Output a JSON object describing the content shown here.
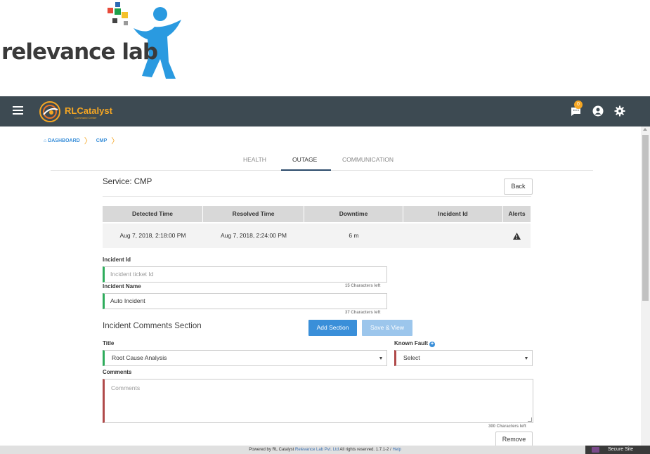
{
  "logo": {
    "text": "relevance lab"
  },
  "topbar": {
    "brand": "RLCatalyst",
    "brand_sub": "Command Center",
    "notification_count": "0"
  },
  "breadcrumb": [
    {
      "label": "DASHBOARD"
    },
    {
      "label": "CMP"
    }
  ],
  "tabs": [
    {
      "label": "HEALTH",
      "active": false
    },
    {
      "label": "OUTAGE",
      "active": true
    },
    {
      "label": "COMMUNICATION",
      "active": false
    }
  ],
  "service": {
    "title": "Service: CMP",
    "back_label": "Back"
  },
  "table": {
    "headers": [
      "Detected Time",
      "Resolved Time",
      "Downtime",
      "Incident Id",
      "Alerts"
    ],
    "rows": [
      {
        "detected": "Aug 7, 2018, 2:18:00 PM",
        "resolved": "Aug 7, 2018, 2:24:00 PM",
        "downtime": "6 m",
        "incident_id": "",
        "alert_icon": "warning-icon"
      }
    ]
  },
  "form": {
    "incident_id_label": "Incident Id",
    "incident_id_placeholder": "Incident ticket Id",
    "incident_id_chars": "15 Characters left",
    "incident_name_label": "Incident Name",
    "incident_name_value": "Auto Incident",
    "incident_name_chars": "37 Characters left",
    "section_title": "Incident Comments Section",
    "add_section_label": "Add Section",
    "save_view_label": "Save & View",
    "title_label": "Title",
    "title_value": "Root Cause Analysis",
    "known_fault_label": "Known Fault",
    "known_fault_value": "Select",
    "comments_label": "Comments",
    "comments_placeholder": "Comments",
    "comments_chars": "300 Characters left",
    "remove_label": "Remove"
  },
  "footer": {
    "prefix": "Powered by RL Catalyst",
    "company": "Relevance Lab Pvt. Ltd",
    "suffix": "All rights reserved. 1.7.1-2 /",
    "help": "Help",
    "secure": "Secure Site"
  },
  "colors": {
    "topbar": "#3d4a52",
    "accent": "#f5a623",
    "primary": "#3a8fd9",
    "valid": "#2eac5c",
    "invalid": "#b04a4a"
  }
}
